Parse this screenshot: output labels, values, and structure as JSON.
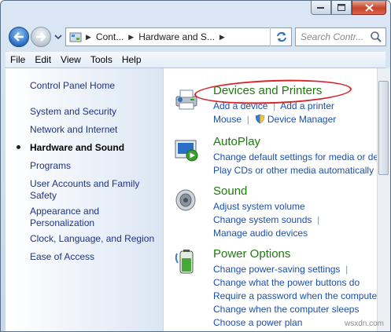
{
  "address": {
    "crumbs": [
      "Cont...",
      "Hardware and S..."
    ]
  },
  "search": {
    "placeholder": "Search Contr..."
  },
  "menu": [
    "File",
    "Edit",
    "View",
    "Tools",
    "Help"
  ],
  "sidebar": {
    "home": "Control Panel Home",
    "items": [
      "System and Security",
      "Network and Internet",
      "Hardware and Sound",
      "Programs",
      "User Accounts and Family Safety",
      "Appearance and Personalization",
      "Clock, Language, and Region",
      "Ease of Access"
    ],
    "active_index": 2
  },
  "categories": [
    {
      "title": "Devices and Printers",
      "icon": "printer-icon",
      "links": [
        "Add a device",
        "Add a printer",
        "Mouse",
        "Device Manager"
      ]
    },
    {
      "title": "AutoPlay",
      "icon": "autoplay-icon",
      "links": [
        "Change default settings for media or devices",
        "Play CDs or other media automatically"
      ]
    },
    {
      "title": "Sound",
      "icon": "speaker-icon",
      "links": [
        "Adjust system volume",
        "Change system sounds",
        "Manage audio devices"
      ]
    },
    {
      "title": "Power Options",
      "icon": "battery-icon",
      "links": [
        "Change power-saving settings",
        "Change what the power buttons do",
        "Require a password when the computer wakes",
        "Change when the computer sleeps",
        "Choose a power plan"
      ]
    }
  ],
  "watermark": "wsxdn.com",
  "colors": {
    "category_title": "#1d7a0d",
    "link": "#1a4fb1",
    "highlight_ring": "#d9232b"
  }
}
